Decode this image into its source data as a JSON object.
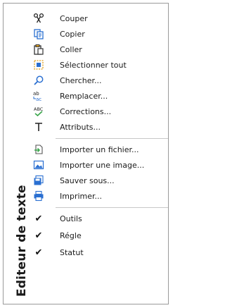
{
  "menu": {
    "title": "Editeur de texte",
    "items": [
      {
        "label": "Couper",
        "icon": "scissors-icon"
      },
      {
        "label": "Copier",
        "icon": "copy-icon"
      },
      {
        "label": "Coller",
        "icon": "paste-icon"
      },
      {
        "label": "Sélectionner tout",
        "icon": "select-all-icon"
      },
      {
        "label": "Chercher...",
        "icon": "search-icon"
      },
      {
        "label": "Remplacer...",
        "icon": "replace-icon"
      },
      {
        "label": "Corrections...",
        "icon": "spellcheck-icon"
      },
      {
        "label": "Attributs...",
        "icon": "text-attributes-icon"
      },
      {
        "label": "Importer un fichier...",
        "icon": "import-file-icon"
      },
      {
        "label": "Importer une image...",
        "icon": "import-image-icon"
      },
      {
        "label": "Sauver sous...",
        "icon": "save-as-icon"
      },
      {
        "label": "Imprimer...",
        "icon": "print-icon"
      },
      {
        "label": "Outils",
        "icon": "checkmark-icon",
        "checked": true
      },
      {
        "label": "Régle",
        "icon": "checkmark-icon",
        "checked": true
      },
      {
        "label": "Statut",
        "icon": "checkmark-icon",
        "checked": true
      }
    ]
  },
  "colors": {
    "icon_blue": "#2a6fd1",
    "icon_green": "#3aa64b",
    "icon_orange": "#e0a020"
  }
}
